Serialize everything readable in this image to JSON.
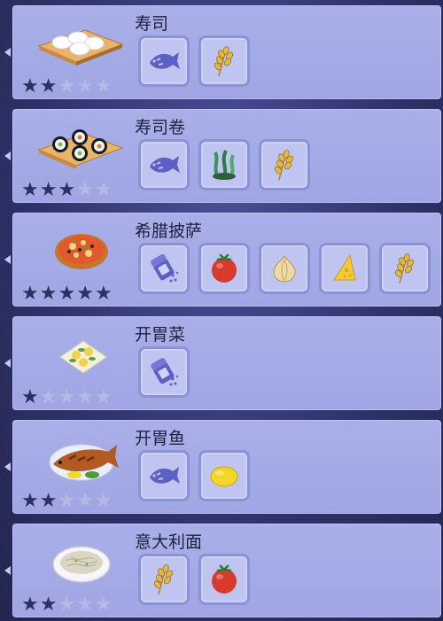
{
  "recipes": [
    {
      "name": "寿司",
      "stars": 2,
      "max_stars": 5,
      "dish_icon": "sushi-icon",
      "ingredients": [
        "fish-icon",
        "wheat-icon"
      ]
    },
    {
      "name": "寿司卷",
      "stars": 3,
      "max_stars": 5,
      "dish_icon": "sushi-roll-icon",
      "ingredients": [
        "fish-icon",
        "seaweed-icon",
        "wheat-icon"
      ]
    },
    {
      "name": "希腊披萨",
      "stars": 5,
      "max_stars": 5,
      "dish_icon": "pizza-icon",
      "ingredients": [
        "salt-icon",
        "tomato-icon",
        "onion-icon",
        "cheese-icon",
        "wheat-icon"
      ]
    },
    {
      "name": "开胃菜",
      "stars": 1,
      "max_stars": 5,
      "dish_icon": "appetizer-icon",
      "ingredients": [
        "salt-icon"
      ]
    },
    {
      "name": "开胃鱼",
      "stars": 2,
      "max_stars": 5,
      "dish_icon": "grilled-fish-icon",
      "ingredients": [
        "fish-icon",
        "lemon-icon"
      ]
    },
    {
      "name": "意大利面",
      "stars": 2,
      "max_stars": 5,
      "dish_icon": "pasta-icon",
      "ingredients": [
        "wheat-icon",
        "tomato-icon"
      ]
    }
  ]
}
